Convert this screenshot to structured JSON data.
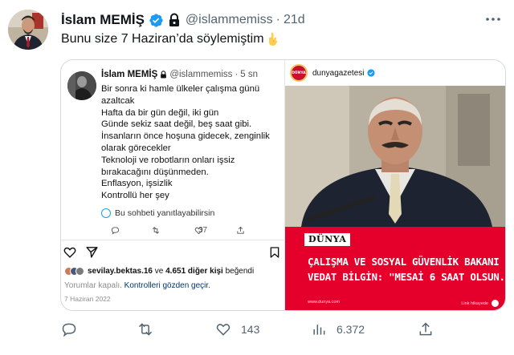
{
  "author": {
    "name": "İslam MEMİŞ",
    "handle": "@islammemiss",
    "separator": "·",
    "time": "21d",
    "verified_icon": "verified-badge-icon",
    "lock_icon": "lock-icon"
  },
  "tweet": {
    "text": "Bunu size 7 Haziran’da söylemiştim",
    "emoji": "pointing-down-hand-emoji"
  },
  "embedded_post": {
    "name": "İslam MEMİŞ",
    "handle": "@islammemiss",
    "separator": "·",
    "time": "5 sn",
    "lines": [
      "Bir sonra ki hamle ülkeler çalışma günü",
      "azaltcak",
      "Hafta da bir gün değil, iki gün",
      "Günde sekiz saat değil, beş saat gibi.",
      "İnsanların önce hoşuna gidecek, zenginlik",
      "olarak görecekler",
      "Teknoloji ve robotların onları işsiz",
      "bırakacağını düşünmeden.",
      "Enflasyon, işsizlik",
      "Kontrollü her şey"
    ],
    "reply_notice": "Bu sohbeti yanıtlayabilirsin",
    "like_count": "37"
  },
  "instagram": {
    "likes_user": "sevilay.bektas.16",
    "likes_mid": " ve ",
    "likes_count": "4.651 diğer kişi",
    "likes_end": " beğendi",
    "comments_off": "Yorumlar kapalı.",
    "controls_link": "Kontrolleri gözden geçir.",
    "date": "7 Haziran 2022"
  },
  "newspaper": {
    "account": "dunyagazetesi",
    "logo_text": "DÜNYA",
    "brand": "DÜNYA",
    "headline_lines": [
      "ÇALIŞMA VE SOSYAL GÜVENLİK BAKANI",
      "VEDAT BİLGİN: \"MESAİ 6 SAAT OLSUN.\""
    ],
    "website": "www.dunya.com",
    "link_text": "Link hikayede"
  },
  "actions": {
    "reply_count": "",
    "retweet_count": "",
    "like_count": "143",
    "views_count": "6.372"
  },
  "colors": {
    "accent": "#1d9bf0",
    "secondary_text": "#536471",
    "news_red": "#e4002b"
  }
}
